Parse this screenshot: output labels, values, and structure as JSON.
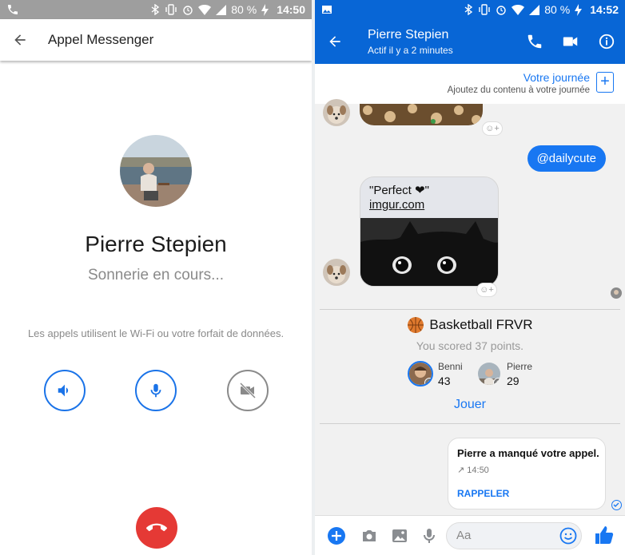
{
  "status_bar": {
    "battery": "80 %",
    "left_time": "14:50",
    "right_time": "14:52"
  },
  "call_screen": {
    "header_title": "Appel Messenger",
    "contact_name": "Pierre Stepien",
    "call_status": "Sonnerie en cours...",
    "network_note": "Les appels utilisent le Wi-Fi ou votre forfait de données.",
    "icons": [
      "back-arrow-icon",
      "speaker-icon",
      "microphone-icon",
      "video-off-icon",
      "hang-up-icon"
    ],
    "colors": {
      "accent": "#1a73e8",
      "hangup": "#e53935"
    }
  },
  "chat_screen": {
    "contact_name": "Pierre Stepien",
    "active_status": "Actif il y a 2 minutes",
    "day_title": "Votre journée",
    "day_subtitle": "Ajoutez du contenu à votre journée",
    "sent_message": "@dailycute",
    "link_card": {
      "line1": "\"Perfect ❤\"",
      "line2": "imgur.com"
    },
    "game": {
      "name": "Basketball FRVR",
      "score_text": "You scored 37 points.",
      "players": [
        {
          "name": "Benni",
          "score": "43",
          "rank": "1"
        },
        {
          "name": "Pierre",
          "score": "29",
          "rank": "2"
        }
      ],
      "play_label": "Jouer"
    },
    "missed_call": {
      "title": "Pierre a manqué votre appel.",
      "time": "↗ 14:50",
      "action": "RAPPELER"
    },
    "composer_placeholder": "Aa",
    "reaction_glyph": "☺+",
    "colors": {
      "header": "#0866d6",
      "accent": "#1877f2"
    }
  }
}
